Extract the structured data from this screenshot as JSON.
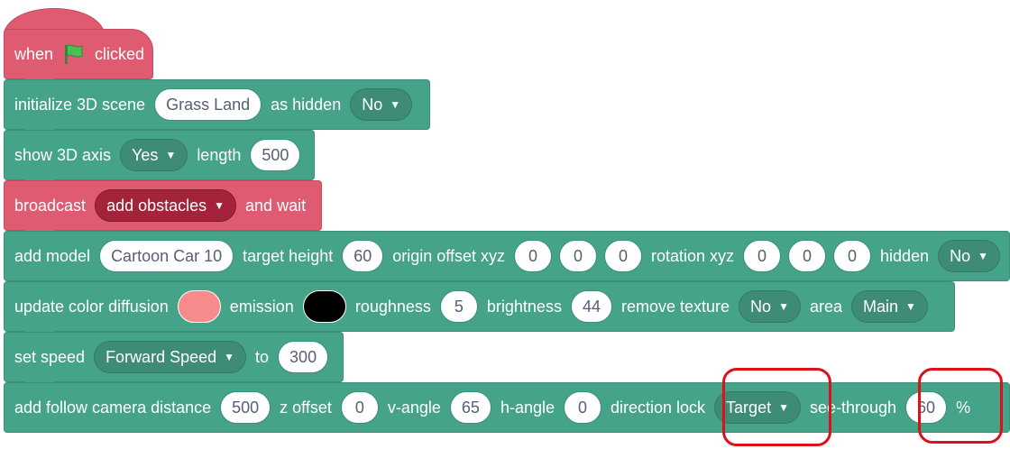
{
  "blocks": {
    "when_flag": {
      "when": "when",
      "clicked": "clicked"
    },
    "init_scene": {
      "label": "initialize 3D scene",
      "scene": "Grass Land",
      "as_hidden": "as hidden",
      "hidden_value": "No"
    },
    "show_axis": {
      "label": "show 3D axis",
      "value": "Yes",
      "length_label": "length",
      "length": "500"
    },
    "broadcast": {
      "label": "broadcast",
      "message": "add obstacles",
      "suffix": "and wait"
    },
    "add_model": {
      "label": "add model",
      "model": "Cartoon Car 10",
      "target_height_label": "target height",
      "target_height": "60",
      "origin_label": "origin offset xyz",
      "ox": "0",
      "oy": "0",
      "oz": "0",
      "rotation_label": "rotation xyz",
      "rx": "0",
      "ry": "0",
      "rz": "0",
      "hidden_label": "hidden",
      "hidden_value": "No"
    },
    "update_color": {
      "label": "update color diffusion",
      "diffusion_color": "#f78a8a",
      "emission_label": "emission",
      "emission_color": "#000000",
      "roughness_label": "roughness",
      "roughness": "5",
      "brightness_label": "brightness",
      "brightness": "44",
      "remove_texture_label": "remove texture",
      "remove_texture": "No",
      "area_label": "area",
      "area": "Main"
    },
    "set_speed": {
      "label": "set speed",
      "speed_type": "Forward Speed",
      "to": "to",
      "value": "300"
    },
    "follow_camera": {
      "label": "add follow camera distance",
      "distance": "500",
      "z_label": "z offset",
      "z": "0",
      "v_label": "v-angle",
      "v": "65",
      "h_label": "h-angle",
      "h": "0",
      "lock_label": "direction lock",
      "lock": "Target",
      "see_label": "see-through",
      "see": "60",
      "percent": "%"
    }
  },
  "colors": {
    "block_teal": "#44a388",
    "block_red": "#df5b72",
    "annotation": "#e0101a",
    "flag": "#4cbf56"
  }
}
